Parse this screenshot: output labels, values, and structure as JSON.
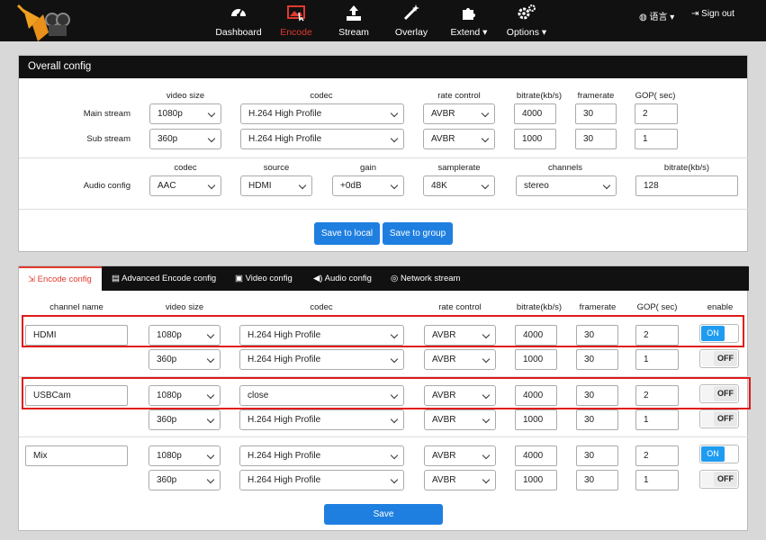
{
  "nav": {
    "items": [
      {
        "key": "dashboard",
        "label": "Dashboard",
        "icon": "gauge-icon"
      },
      {
        "key": "encode",
        "label": "Encode",
        "icon": "image-icon",
        "active": true
      },
      {
        "key": "stream",
        "label": "Stream",
        "icon": "upload-icon"
      },
      {
        "key": "overlay",
        "label": "Overlay",
        "icon": "magic-wand-icon"
      },
      {
        "key": "extend",
        "label": "Extend",
        "icon": "puzzle-icon"
      },
      {
        "key": "options",
        "label": "Options",
        "icon": "gears-icon"
      }
    ],
    "language": "语言",
    "signout": "Sign out"
  },
  "overall": {
    "title": "Overall config",
    "video_headers": {
      "size": "video size",
      "codec": "codec",
      "rate": "rate control",
      "bitrate": "bitrate(kb/s)",
      "framerate": "framerate",
      "gop": "GOP( sec)"
    },
    "main": {
      "label": "Main stream",
      "size": "1080p",
      "codec": "H.264 High Profile",
      "rate": "AVBR",
      "bitrate": "4000",
      "framerate": "30",
      "gop": "2"
    },
    "sub": {
      "label": "Sub stream",
      "size": "360p",
      "codec": "H.264 High Profile",
      "rate": "AVBR",
      "bitrate": "1000",
      "framerate": "30",
      "gop": "1"
    },
    "audio_headers": {
      "codec": "codec",
      "source": "source",
      "gain": "gain",
      "samplerate": "samplerate",
      "channels": "channels",
      "bitrate": "bitrate(kb/s)"
    },
    "audio": {
      "label": "Audio config",
      "codec": "AAC",
      "source": "HDMI",
      "gain": "+0dB",
      "samplerate": "48K",
      "channels": "stereo",
      "bitrate": "128"
    },
    "save_local": "Save to local",
    "save_group": "Save to group"
  },
  "tabs": [
    {
      "label": "Encode config",
      "icon": "sign-in-icon",
      "active": true
    },
    {
      "label": "Advanced Encode config",
      "icon": "document-icon"
    },
    {
      "label": "Video config",
      "icon": "image-icon"
    },
    {
      "label": "Audio config",
      "icon": "volume-icon"
    },
    {
      "label": "Network stream",
      "icon": "globe-icon"
    }
  ],
  "encode": {
    "headers": {
      "name": "channel name",
      "size": "video size",
      "codec": "codec",
      "rate": "rate control",
      "bitrate": "bitrate(kb/s)",
      "framerate": "framerate",
      "gop": "GOP( sec)",
      "enable": "enable"
    },
    "channels": [
      {
        "name": "HDMI",
        "main": {
          "size": "1080p",
          "codec": "H.264 High Profile",
          "rate": "AVBR",
          "bitrate": "4000",
          "framerate": "30",
          "gop": "2",
          "enable": "ON"
        },
        "sub": {
          "size": "360p",
          "codec": "H.264 High Profile",
          "rate": "AVBR",
          "bitrate": "1000",
          "framerate": "30",
          "gop": "1",
          "enable": "OFF"
        }
      },
      {
        "name": "USBCam",
        "main": {
          "size": "1080p",
          "codec": "close",
          "rate": "AVBR",
          "bitrate": "4000",
          "framerate": "30",
          "gop": "2",
          "enable": "OFF"
        },
        "sub": {
          "size": "360p",
          "codec": "H.264 High Profile",
          "rate": "AVBR",
          "bitrate": "1000",
          "framerate": "30",
          "gop": "1",
          "enable": "OFF"
        }
      },
      {
        "name": "Mix",
        "main": {
          "size": "1080p",
          "codec": "H.264 High Profile",
          "rate": "AVBR",
          "bitrate": "4000",
          "framerate": "30",
          "gop": "2",
          "enable": "ON"
        },
        "sub": {
          "size": "360p",
          "codec": "H.264 High Profile",
          "rate": "AVBR",
          "bitrate": "1000",
          "framerate": "30",
          "gop": "1",
          "enable": "OFF"
        }
      }
    ],
    "save": "Save"
  },
  "colors": {
    "accent": "#1f7fe0",
    "active_nav": "#e03a2f",
    "highlight": "#e01a1a",
    "toggle_on": "#1f9cf0"
  }
}
